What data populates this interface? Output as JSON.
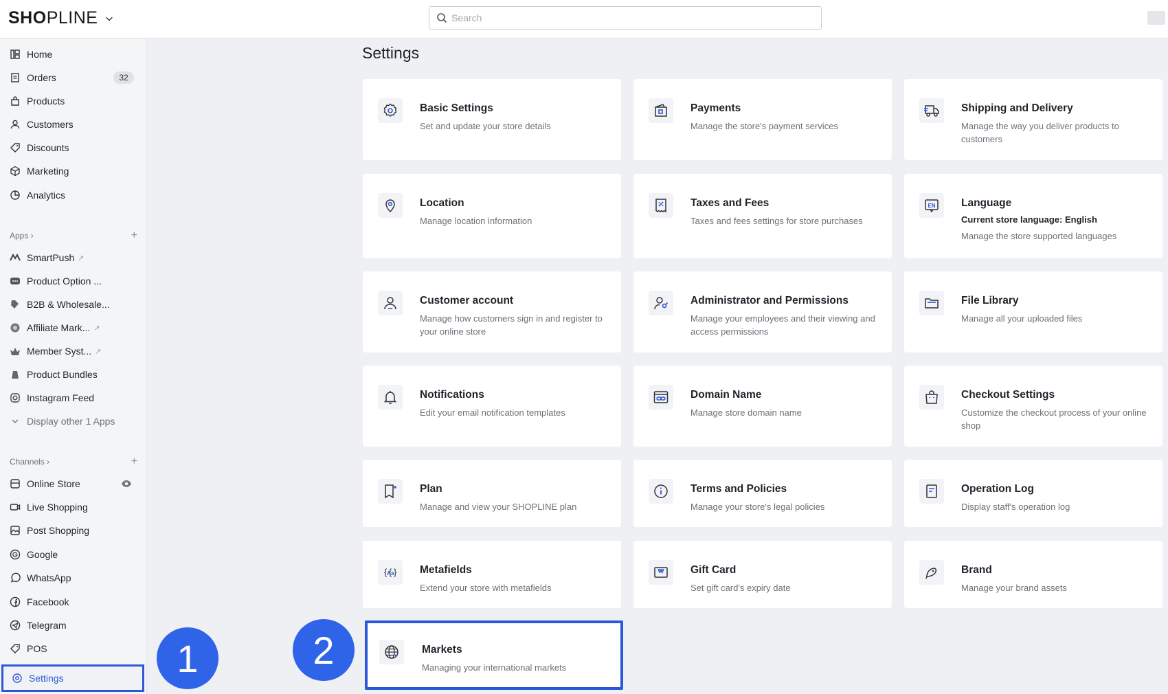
{
  "header": {
    "logo_bold": "SH",
    "logo_o": "O",
    "logo_rest": "PLINE",
    "search_placeholder": "Search"
  },
  "sidebar": {
    "main_items": [
      {
        "label": "Home",
        "icon": "home-icon"
      },
      {
        "label": "Orders",
        "icon": "orders-icon",
        "badge": "32"
      },
      {
        "label": "Products",
        "icon": "products-icon"
      },
      {
        "label": "Customers",
        "icon": "customers-icon"
      },
      {
        "label": "Discounts",
        "icon": "discount-tag-icon"
      },
      {
        "label": "Marketing",
        "icon": "marketing-icon"
      },
      {
        "label": "Analytics",
        "icon": "analytics-icon"
      }
    ],
    "apps_label": "Apps",
    "apps": [
      {
        "label": "SmartPush",
        "icon": "smartpush-icon"
      },
      {
        "label": "Product Option ...",
        "icon": "product-option-icon"
      },
      {
        "label": "B2B & Wholesale...",
        "icon": "b2b-icon"
      },
      {
        "label": "Affiliate Mark...",
        "icon": "affiliate-icon"
      },
      {
        "label": "Member Syst...",
        "icon": "member-icon"
      },
      {
        "label": "Product Bundles",
        "icon": "bundles-icon"
      },
      {
        "label": "Instagram Feed",
        "icon": "instagram-icon"
      },
      {
        "label": "Display other 1 Apps",
        "icon": "chevron-down-icon"
      }
    ],
    "channels_label": "Channels",
    "channels": [
      {
        "label": "Online Store",
        "icon": "online-store-icon"
      },
      {
        "label": "Live Shopping",
        "icon": "live-shopping-icon"
      },
      {
        "label": "Post Shopping",
        "icon": "post-shopping-icon"
      },
      {
        "label": "Google",
        "icon": "google-icon"
      },
      {
        "label": "WhatsApp",
        "icon": "whatsapp-icon"
      },
      {
        "label": "Facebook",
        "icon": "facebook-icon"
      },
      {
        "label": "Telegram",
        "icon": "telegram-icon"
      },
      {
        "label": "POS",
        "icon": "pos-icon"
      }
    ],
    "settings_label": "Settings"
  },
  "main": {
    "title": "Settings",
    "cards": [
      {
        "title": "Basic Settings",
        "desc": "Set and update your store details",
        "icon": "gear-icon"
      },
      {
        "title": "Payments",
        "desc": "Manage the store's payment services",
        "icon": "wallet-icon"
      },
      {
        "title": "Shipping and Delivery",
        "desc": "Manage the way you deliver products to customers",
        "icon": "truck-icon"
      },
      {
        "title": "Location",
        "desc": "Manage location information",
        "icon": "location-pin-icon"
      },
      {
        "title": "Taxes and Fees",
        "desc": "Taxes and fees settings for store purchases",
        "icon": "receipt-icon"
      },
      {
        "title": "Language",
        "strong": "Current store language: English",
        "desc": "Manage the store supported languages",
        "icon": "language-en-icon"
      },
      {
        "title": "Customer account",
        "desc": "Manage how customers sign in and register to your online store",
        "icon": "user-icon"
      },
      {
        "title": "Administrator and Permissions",
        "desc": "Manage your employees and their viewing and access permissions",
        "icon": "admin-key-icon"
      },
      {
        "title": "File Library",
        "desc": "Manage all your uploaded files",
        "icon": "folder-icon"
      },
      {
        "title": "Notifications",
        "desc": "Edit your email notification templates",
        "icon": "bell-icon"
      },
      {
        "title": "Domain Name",
        "desc": "Manage store domain name",
        "icon": "link-window-icon"
      },
      {
        "title": "Checkout Settings",
        "desc": "Customize the checkout process of your online shop",
        "icon": "shopping-bag-icon"
      },
      {
        "title": "Plan",
        "desc": "Manage and view your SHOPLINE plan",
        "icon": "plan-flag-icon"
      },
      {
        "title": "Terms and Policies",
        "desc": "Manage your store's legal policies",
        "icon": "info-icon"
      },
      {
        "title": "Operation Log",
        "desc": "Display staff's operation log",
        "icon": "log-icon"
      },
      {
        "title": "Metafields",
        "desc": "Extend your store with metafields",
        "icon": "metafields-icon"
      },
      {
        "title": "Gift Card",
        "desc": "Set gift card's expiry date",
        "icon": "gift-card-icon"
      },
      {
        "title": "Brand",
        "desc": "Manage your brand assets",
        "icon": "brand-icon"
      },
      {
        "title": "Markets",
        "desc": "Managing your international markets",
        "icon": "globe-icon"
      }
    ]
  },
  "markers": {
    "one": "1",
    "two": "2"
  },
  "colors": {
    "accent": "#2b57d9",
    "marker": "#2f63e8",
    "page_bg": "#eef0f3"
  }
}
